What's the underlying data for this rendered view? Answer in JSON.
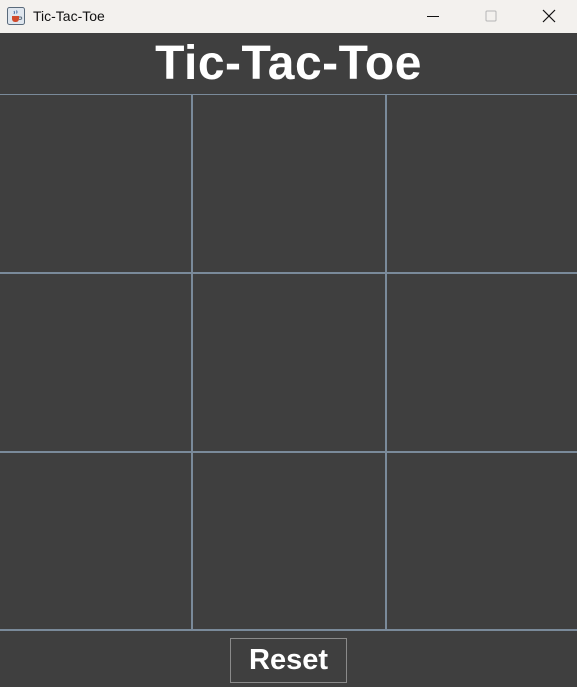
{
  "window": {
    "title": "Tic-Tac-Toe",
    "app_icon": "java-coffee-cup-icon",
    "controls": [
      "minimize-icon",
      "maximize-icon",
      "close-icon"
    ]
  },
  "header": {
    "title": "Tic-Tac-Toe"
  },
  "board": {
    "cells": [
      [
        "",
        "",
        ""
      ],
      [
        "",
        "",
        ""
      ],
      [
        "",
        "",
        ""
      ]
    ]
  },
  "footer": {
    "reset_label": "Reset"
  },
  "colors": {
    "background": "#3f3f3f",
    "grid_line": "#7a8a9a",
    "text": "#ffffff",
    "titlebar": "#f3f1ee"
  }
}
